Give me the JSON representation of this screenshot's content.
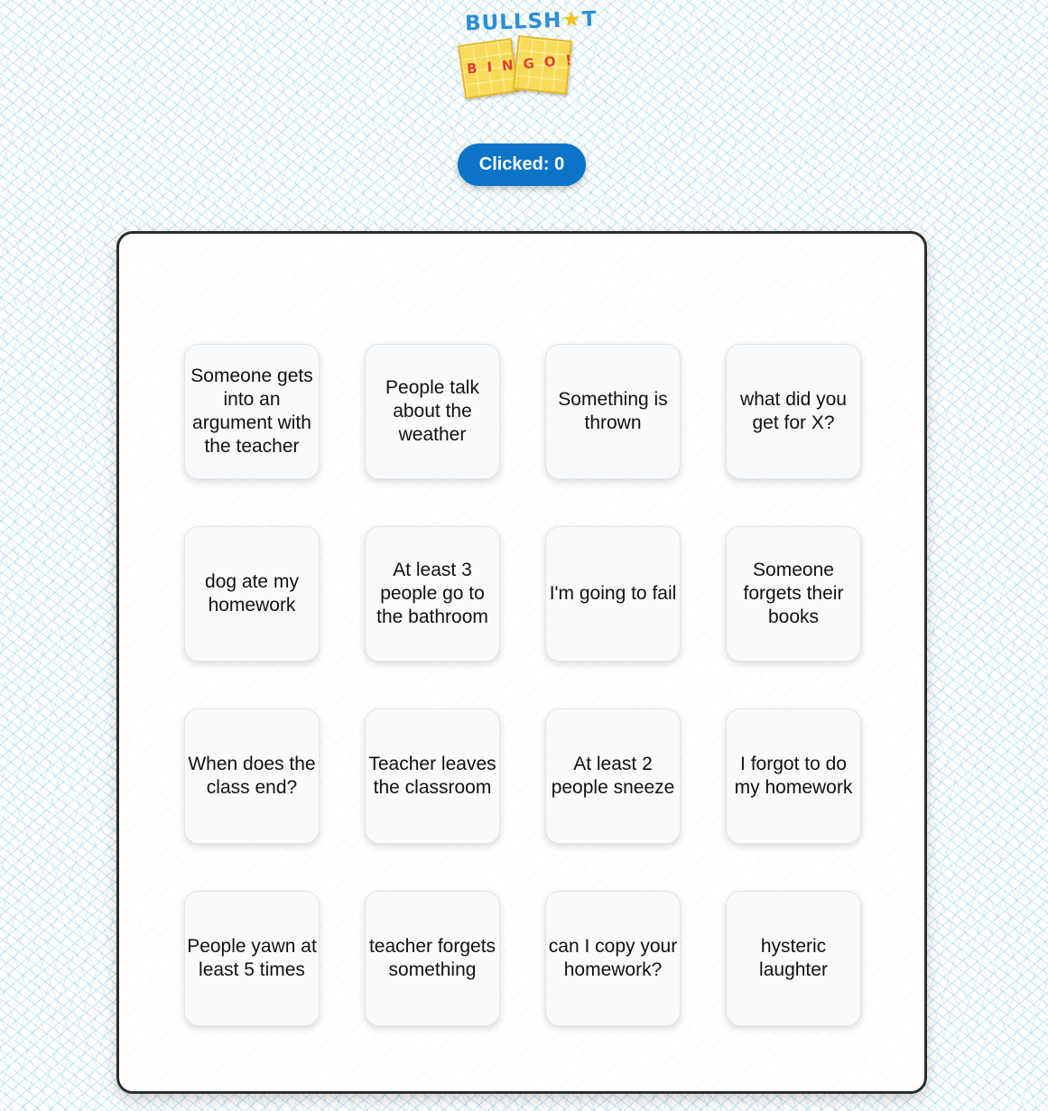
{
  "logo": {
    "top_text": "BULLSH",
    "top_text_end": "T",
    "star_glyph": "★",
    "bottom_text": "BINGO!"
  },
  "counter": {
    "label": "Clicked: 0"
  },
  "colors": {
    "accent": "#0b74c8",
    "logo_blue": "#2b8ed4",
    "logo_yellow": "#f0c21a",
    "logo_red": "#e0402f",
    "board_border": "#2e2e2e"
  },
  "board": {
    "cells": [
      {
        "label": "Someone gets into an argument with the teacher"
      },
      {
        "label": "People talk about the weather"
      },
      {
        "label": "Something is thrown"
      },
      {
        "label": "what did you get for X?"
      },
      {
        "label": "dog ate my homework"
      },
      {
        "label": "At least 3 people go to the bathroom"
      },
      {
        "label": "I'm going to fail"
      },
      {
        "label": "Someone forgets their books"
      },
      {
        "label": "When does the class end?"
      },
      {
        "label": "Teacher leaves the classroom"
      },
      {
        "label": "At least 2 people sneeze"
      },
      {
        "label": "I forgot to do my homework"
      },
      {
        "label": "People yawn at least 5 times"
      },
      {
        "label": "teacher forgets something"
      },
      {
        "label": "can I copy your homework?"
      },
      {
        "label": "hysteric laughter"
      }
    ]
  }
}
